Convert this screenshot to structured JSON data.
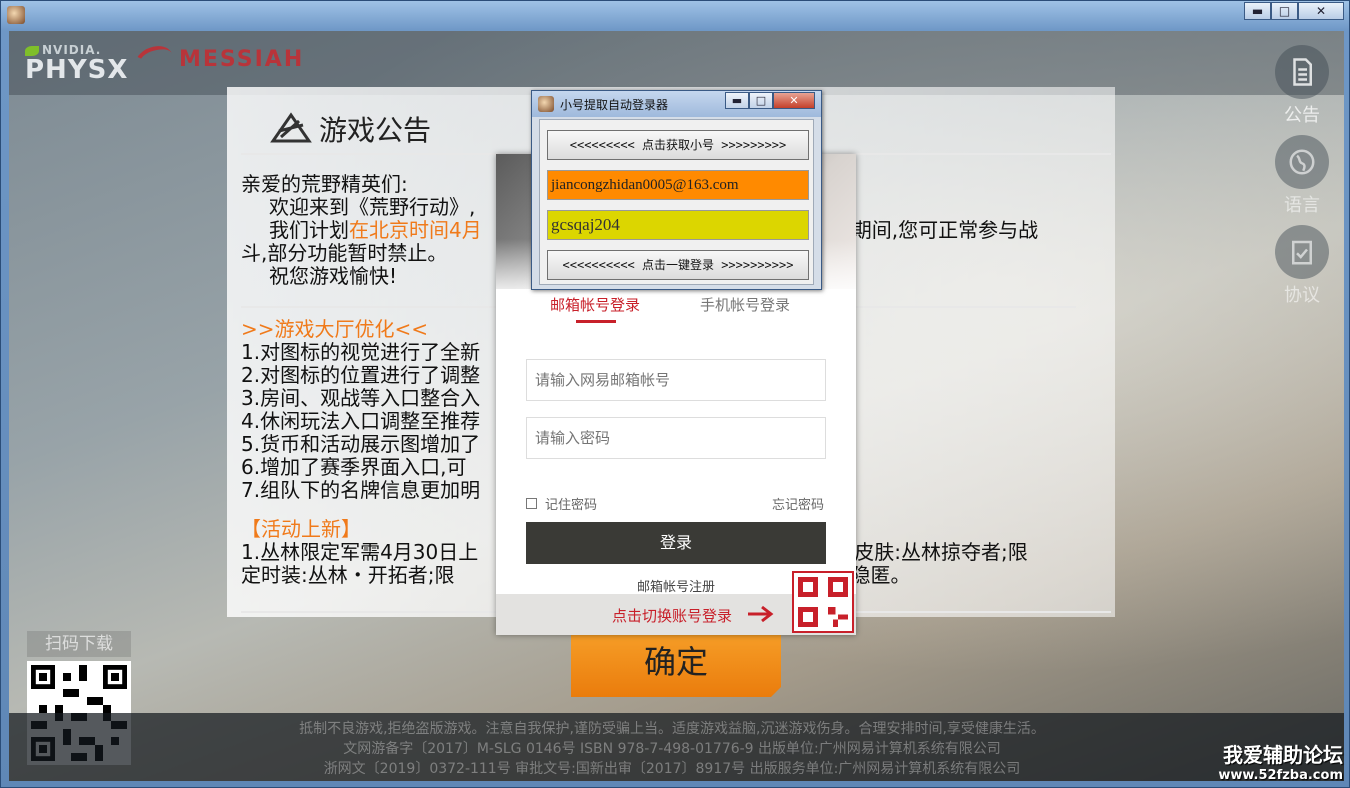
{
  "outer_window": {
    "controls": [
      "▬",
      "□",
      "✕"
    ]
  },
  "logos": {
    "nvidia_small": "NVIDIA.",
    "nvidia_big": "PHYSX",
    "messiah": "MESSIAH"
  },
  "side_menu": [
    {
      "label": "公告",
      "icon": "document-icon"
    },
    {
      "label": "语言",
      "icon": "globe-icon"
    },
    {
      "label": "协议",
      "icon": "clipboard-check-icon"
    }
  ],
  "announcement": {
    "title": "游戏公告",
    "greeting": "亲爱的荒野精英们:",
    "welcome": "欢迎来到《荒野行动》,",
    "plan_prefix": "我们计划",
    "plan_highlight": "在北京时间4月",
    "plan_suffix": "护期间,您可正常参与战",
    "plan_cont": "斗,部分功能暂时禁止。",
    "wish": "祝您游戏愉快!",
    "section1_title": ">>游戏大厅优化<<",
    "section1_items": [
      "1.对图标的视觉进行了全新",
      "2.对图标的位置进行了调整",
      "3.房间、观战等入口整合入",
      "4.休闲玩法入口调整至推荐",
      "5.货币和活动展示图增加了",
      "6.增加了赛季界面入口,可",
      "7.组队下的名牌信息更加明"
    ],
    "section2_title": "【活动上新】",
    "section2_line1_a": "1.丛林限定军需4月30日上",
    "section2_line1_b": "具皮肤:丛林掠夺者;限",
    "section2_line2_a": "定时装:丛林・开拓者;限",
    "section2_line2_b": "林・隐匿。"
  },
  "confirm_button": "确定",
  "qr_download_label": "扫码下载",
  "footer": {
    "line1": "抵制不良游戏,拒绝盗版游戏。注意自我保护,谨防受骗上当。适度游戏益脑,沉迷游戏伤身。合理安排时间,享受健康生活。",
    "line2": "文网游备字〔2017〕M-SLG 0146号   ISBN 978-7-498-01776-9   出版单位:广州网易计算机系统有限公司",
    "line3": "浙网文〔2019〕0372-111号   审批文号:国新出审〔2017〕8917号   出版服务单位:广州网易计算机系统有限公司"
  },
  "watermark": {
    "cn": "我爱辅助论坛",
    "url": "www.52fzba.com"
  },
  "login": {
    "tab_email": "邮箱帐号登录",
    "tab_phone": "手机帐号登录",
    "email_placeholder": "请输入网易邮箱帐号",
    "password_placeholder": "请输入密码",
    "remember": "记住密码",
    "forgot": "忘记密码",
    "login_button": "登录",
    "register": "邮箱帐号注册",
    "switch_text": "点击切换账号登录"
  },
  "tool_window": {
    "title": "小号提取自动登录器",
    "controls": [
      "▬",
      "□",
      "✕"
    ],
    "get_button": "<<<<<<<<< 点击获取小号 >>>>>>>>>",
    "account_value": "jiancongzhidan0005@163.com",
    "password_value": "gcsqaj204",
    "login_button": "<<<<<<<<<< 点击一键登录 >>>>>>>>>>",
    "account_bg": "#ff8a00",
    "password_bg": "#dcd600"
  },
  "colors": {
    "accent_orange": "#f07a1a",
    "netease_red": "#c8202a"
  }
}
